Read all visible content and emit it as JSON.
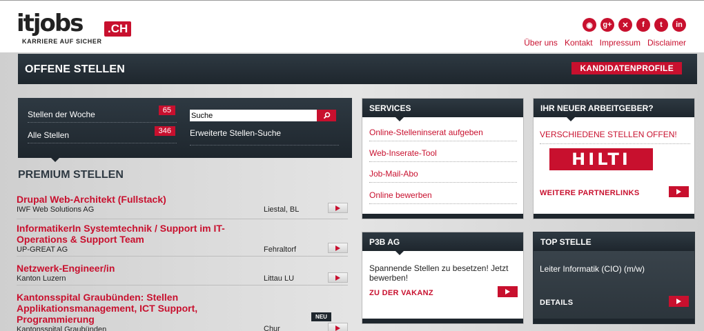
{
  "header": {
    "logo_text": "itjobs",
    "logo_suffix": ".CH",
    "tagline": "KARRIERE AUF SICHER",
    "social": [
      {
        "icon": "rss-icon",
        "glyph": "◉"
      },
      {
        "icon": "google-plus-icon",
        "glyph": "g+"
      },
      {
        "icon": "xing-icon",
        "glyph": "✕"
      },
      {
        "icon": "facebook-icon",
        "glyph": "f"
      },
      {
        "icon": "twitter-icon",
        "glyph": "t"
      },
      {
        "icon": "linkedin-icon",
        "glyph": "in"
      }
    ],
    "nav": [
      "Über uns",
      "Kontakt",
      "Impressum",
      "Disclaimer"
    ]
  },
  "titlebar": {
    "title": "OFFENE STELLEN",
    "button": "KANDIDATENPROFILE"
  },
  "search": {
    "week_label": "Stellen der Woche",
    "week_count": "65",
    "all_label": "Alle Stellen",
    "all_count": "346",
    "input_value": "Suche",
    "advanced": "Erweiterte Stellen-Suche"
  },
  "premium": {
    "heading": "PREMIUM STELLEN",
    "jobs": [
      {
        "title": "Drupal Web-Architekt (Fullstack)",
        "company": "IWF Web Solutions AG",
        "location": "Liestal, BL"
      },
      {
        "title": "InformatikerIn Systemtechnik / Support im IT-Operations & Support Team",
        "company": "UP-GREAT AG",
        "location": "Fehraltorf"
      },
      {
        "title": "Netzwerk-Engineer/in",
        "company": "Kanton Luzern",
        "location": "Littau LU"
      },
      {
        "title": "Kantonsspital Graubünden: Stellen Applikationsmanagement, ICT Support, Programmierung",
        "company": "Kantonsspital Graubünden",
        "location": "Chur",
        "badge": "NEU"
      }
    ]
  },
  "services": {
    "title": "SERVICES",
    "links": [
      "Online-Stelleninserat aufgeben",
      "Web-Inserate-Tool",
      "Job-Mail-Abo",
      "Online bewerben"
    ]
  },
  "employer": {
    "title": "IHR NEUER ARBEITGEBER?",
    "headline": "VERSCHIEDENE STELLEN OFFEN!",
    "logo": "HILTI",
    "more": "WEITERE PARTNERLINKS"
  },
  "p3b": {
    "title": "P3B AG",
    "text": "Spannende Stellen zu besetzen! Jetzt bewerben!",
    "link": "ZU DER VAKANZ"
  },
  "top": {
    "title": "TOP STELLE",
    "text": "Leiter Informatik (CIO) (m/w)",
    "link": "DETAILS"
  }
}
